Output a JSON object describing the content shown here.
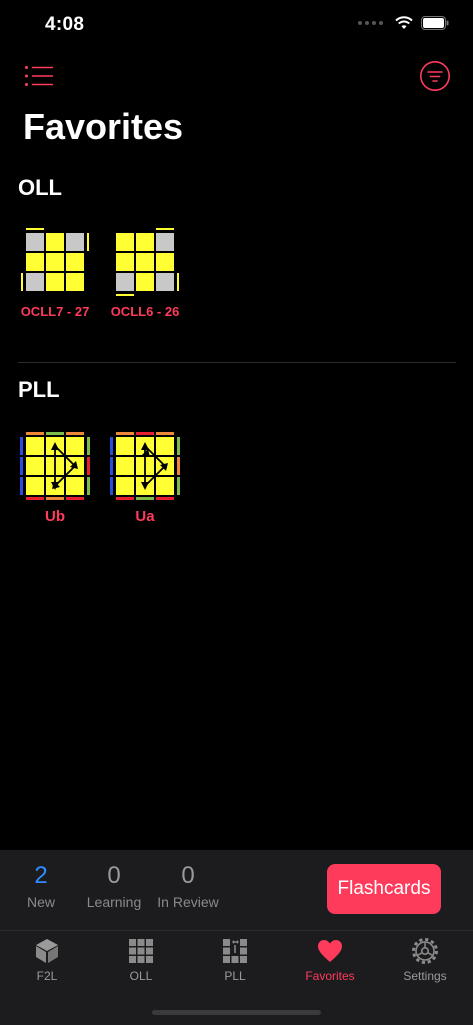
{
  "status": {
    "time": "4:08"
  },
  "icons": {
    "menu": "list-icon",
    "filter": "filter-icon"
  },
  "page": {
    "title": "Favorites"
  },
  "sections": {
    "oll": {
      "title": "OLL",
      "items": [
        {
          "label": "OCLL7 - 27"
        },
        {
          "label": "OCLL6 - 26"
        }
      ]
    },
    "pll": {
      "title": "PLL",
      "items": [
        {
          "label": "Ub"
        },
        {
          "label": "Ua"
        }
      ]
    }
  },
  "stats": {
    "new": {
      "value": "2",
      "label": "New"
    },
    "learning": {
      "value": "0",
      "label": "Learning"
    },
    "review": {
      "value": "0",
      "label": "In Review"
    }
  },
  "flashcards_label": "Flashcards",
  "tabs": [
    {
      "label": "F2L",
      "icon": "cube-icon"
    },
    {
      "label": "OLL",
      "icon": "grid-icon"
    },
    {
      "label": "PLL",
      "icon": "pll-icon"
    },
    {
      "label": "Favorites",
      "icon": "heart-icon",
      "active": true
    },
    {
      "label": "Settings",
      "icon": "gear-icon"
    }
  ],
  "colors": {
    "accent": "#ff3b5c",
    "blue": "#2f8bff",
    "sticker_yellow": "#ffff33",
    "sticker_gray": "#c8c8c8",
    "orange": "#f0883a",
    "green": "#7dbb4a",
    "red": "#e8202f",
    "sideblue": "#2a4fd8"
  }
}
